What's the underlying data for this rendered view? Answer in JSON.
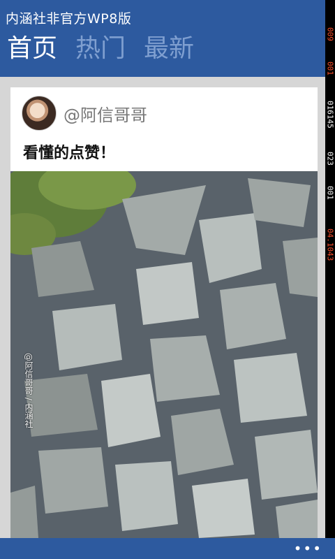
{
  "header": {
    "app_title": "内涵社非官方WP8版",
    "tabs": [
      {
        "label": "首页",
        "active": true
      },
      {
        "label": "热门",
        "active": false
      },
      {
        "label": "最新",
        "active": false
      }
    ]
  },
  "debug_counters": [
    "009",
    "001",
    "016145",
    "023",
    "001",
    "04.1043"
  ],
  "post": {
    "author": "@阿信哥哥",
    "text": "看懂的点赞！",
    "image_watermark": "@阿信哥哥 / 内涵社"
  },
  "appbar": {
    "more_label": "•••"
  },
  "colors": {
    "accent": "#2d5a9f",
    "inactive_tab": "#7f9fd0",
    "page_bg": "#d6d6d6",
    "debug_red": "#ff4f2a"
  }
}
